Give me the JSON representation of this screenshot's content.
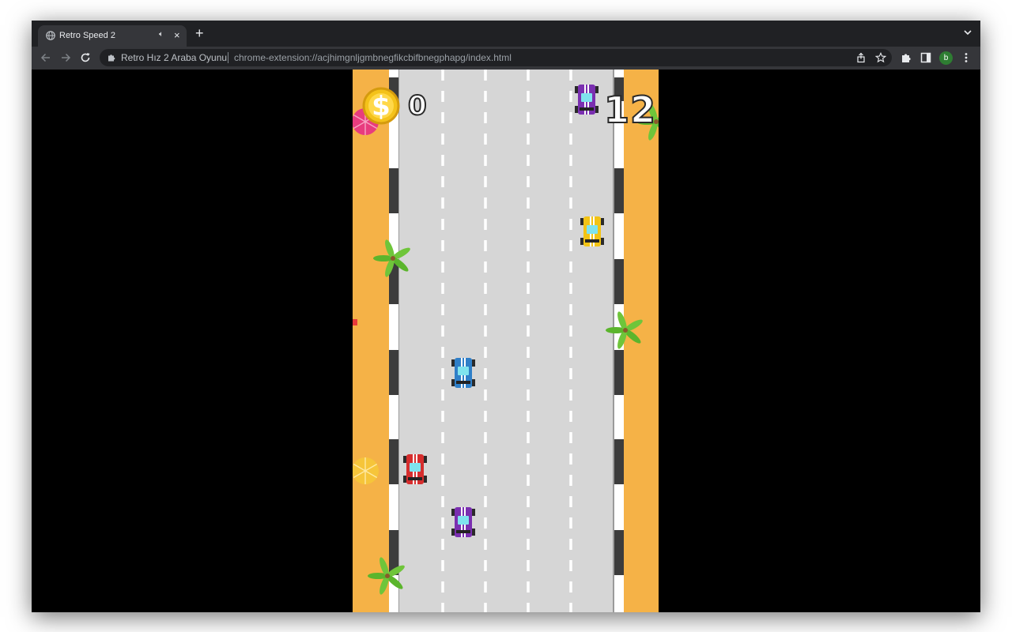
{
  "tab": {
    "title": "Retro Speed 2",
    "close": "×",
    "audio": "🔈︎"
  },
  "toolbar": {
    "site_name": "Retro Hız 2 Araba Oyunu",
    "url": "chrome-extension://acjhimgnljgmbnegfikcbifbnegphapg/index.html",
    "profile_initial": "b"
  },
  "newtab": {
    "label": "+"
  },
  "game": {
    "coins": "0",
    "countdown": "12"
  },
  "colors": {
    "sand": "#f5b247",
    "road": "#d6d6d6",
    "lane": "#ffffff",
    "curb_dark": "#3c3c3c",
    "car_blue": "#2f7fc8",
    "car_red": "#d62d2d",
    "car_purple": "#7a2fb0",
    "car_yellow": "#f2c315",
    "coin": "#f4c21a",
    "palm": "#6fc53a",
    "umbrella_pink": "#e83c7e",
    "umbrella_yellow": "#f6c53a"
  },
  "icons": [
    "globe-icon",
    "speaker-icon",
    "close-icon",
    "plus-icon",
    "chevron-down-icon",
    "back-arrow-icon",
    "forward-arrow-icon",
    "reload-icon",
    "extension-puzzle-icon",
    "share-icon",
    "bookmark-star-icon",
    "extensions-icon",
    "side-panel-icon",
    "kebab-menu-icon",
    "coin-icon",
    "palm-tree-icon",
    "beach-umbrella-icon",
    "car-icon"
  ]
}
